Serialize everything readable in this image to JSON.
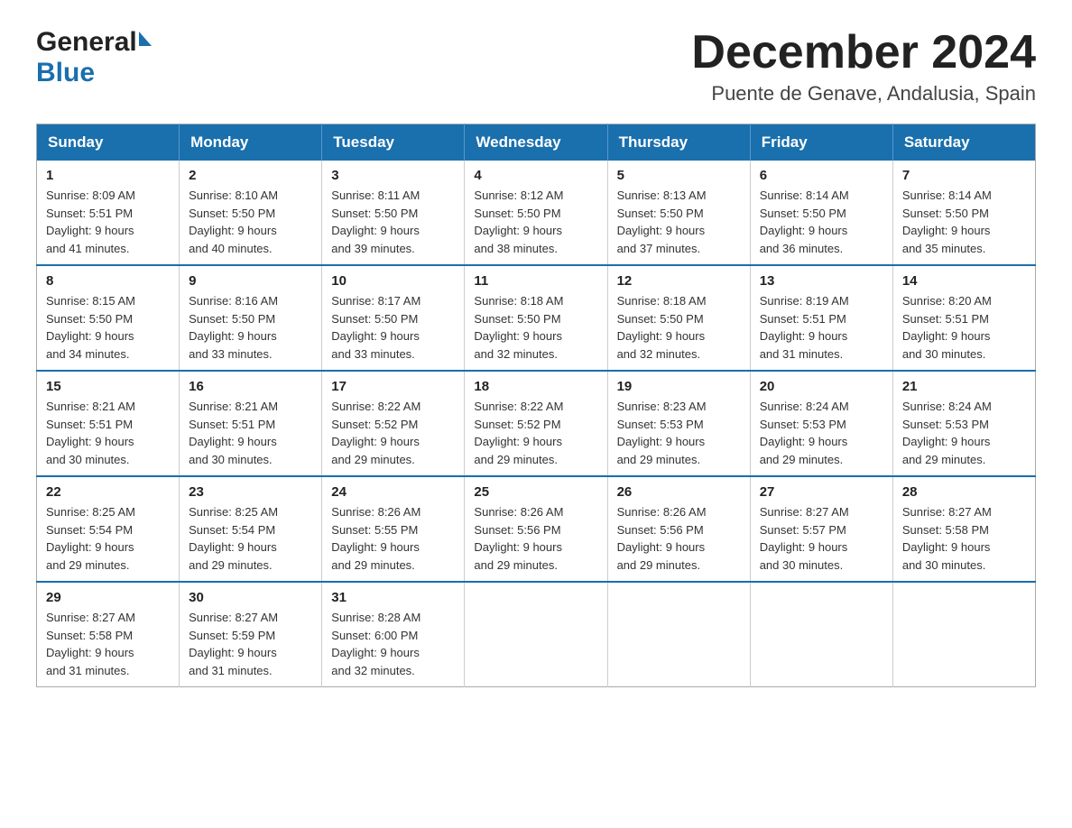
{
  "header": {
    "logo_general": "General",
    "logo_blue": "Blue",
    "month_year": "December 2024",
    "location": "Puente de Genave, Andalusia, Spain"
  },
  "weekdays": [
    "Sunday",
    "Monday",
    "Tuesday",
    "Wednesday",
    "Thursday",
    "Friday",
    "Saturday"
  ],
  "weeks": [
    [
      {
        "day": "1",
        "info": "Sunrise: 8:09 AM\nSunset: 5:51 PM\nDaylight: 9 hours\nand 41 minutes."
      },
      {
        "day": "2",
        "info": "Sunrise: 8:10 AM\nSunset: 5:50 PM\nDaylight: 9 hours\nand 40 minutes."
      },
      {
        "day": "3",
        "info": "Sunrise: 8:11 AM\nSunset: 5:50 PM\nDaylight: 9 hours\nand 39 minutes."
      },
      {
        "day": "4",
        "info": "Sunrise: 8:12 AM\nSunset: 5:50 PM\nDaylight: 9 hours\nand 38 minutes."
      },
      {
        "day": "5",
        "info": "Sunrise: 8:13 AM\nSunset: 5:50 PM\nDaylight: 9 hours\nand 37 minutes."
      },
      {
        "day": "6",
        "info": "Sunrise: 8:14 AM\nSunset: 5:50 PM\nDaylight: 9 hours\nand 36 minutes."
      },
      {
        "day": "7",
        "info": "Sunrise: 8:14 AM\nSunset: 5:50 PM\nDaylight: 9 hours\nand 35 minutes."
      }
    ],
    [
      {
        "day": "8",
        "info": "Sunrise: 8:15 AM\nSunset: 5:50 PM\nDaylight: 9 hours\nand 34 minutes."
      },
      {
        "day": "9",
        "info": "Sunrise: 8:16 AM\nSunset: 5:50 PM\nDaylight: 9 hours\nand 33 minutes."
      },
      {
        "day": "10",
        "info": "Sunrise: 8:17 AM\nSunset: 5:50 PM\nDaylight: 9 hours\nand 33 minutes."
      },
      {
        "day": "11",
        "info": "Sunrise: 8:18 AM\nSunset: 5:50 PM\nDaylight: 9 hours\nand 32 minutes."
      },
      {
        "day": "12",
        "info": "Sunrise: 8:18 AM\nSunset: 5:50 PM\nDaylight: 9 hours\nand 32 minutes."
      },
      {
        "day": "13",
        "info": "Sunrise: 8:19 AM\nSunset: 5:51 PM\nDaylight: 9 hours\nand 31 minutes."
      },
      {
        "day": "14",
        "info": "Sunrise: 8:20 AM\nSunset: 5:51 PM\nDaylight: 9 hours\nand 30 minutes."
      }
    ],
    [
      {
        "day": "15",
        "info": "Sunrise: 8:21 AM\nSunset: 5:51 PM\nDaylight: 9 hours\nand 30 minutes."
      },
      {
        "day": "16",
        "info": "Sunrise: 8:21 AM\nSunset: 5:51 PM\nDaylight: 9 hours\nand 30 minutes."
      },
      {
        "day": "17",
        "info": "Sunrise: 8:22 AM\nSunset: 5:52 PM\nDaylight: 9 hours\nand 29 minutes."
      },
      {
        "day": "18",
        "info": "Sunrise: 8:22 AM\nSunset: 5:52 PM\nDaylight: 9 hours\nand 29 minutes."
      },
      {
        "day": "19",
        "info": "Sunrise: 8:23 AM\nSunset: 5:53 PM\nDaylight: 9 hours\nand 29 minutes."
      },
      {
        "day": "20",
        "info": "Sunrise: 8:24 AM\nSunset: 5:53 PM\nDaylight: 9 hours\nand 29 minutes."
      },
      {
        "day": "21",
        "info": "Sunrise: 8:24 AM\nSunset: 5:53 PM\nDaylight: 9 hours\nand 29 minutes."
      }
    ],
    [
      {
        "day": "22",
        "info": "Sunrise: 8:25 AM\nSunset: 5:54 PM\nDaylight: 9 hours\nand 29 minutes."
      },
      {
        "day": "23",
        "info": "Sunrise: 8:25 AM\nSunset: 5:54 PM\nDaylight: 9 hours\nand 29 minutes."
      },
      {
        "day": "24",
        "info": "Sunrise: 8:26 AM\nSunset: 5:55 PM\nDaylight: 9 hours\nand 29 minutes."
      },
      {
        "day": "25",
        "info": "Sunrise: 8:26 AM\nSunset: 5:56 PM\nDaylight: 9 hours\nand 29 minutes."
      },
      {
        "day": "26",
        "info": "Sunrise: 8:26 AM\nSunset: 5:56 PM\nDaylight: 9 hours\nand 29 minutes."
      },
      {
        "day": "27",
        "info": "Sunrise: 8:27 AM\nSunset: 5:57 PM\nDaylight: 9 hours\nand 30 minutes."
      },
      {
        "day": "28",
        "info": "Sunrise: 8:27 AM\nSunset: 5:58 PM\nDaylight: 9 hours\nand 30 minutes."
      }
    ],
    [
      {
        "day": "29",
        "info": "Sunrise: 8:27 AM\nSunset: 5:58 PM\nDaylight: 9 hours\nand 31 minutes."
      },
      {
        "day": "30",
        "info": "Sunrise: 8:27 AM\nSunset: 5:59 PM\nDaylight: 9 hours\nand 31 minutes."
      },
      {
        "day": "31",
        "info": "Sunrise: 8:28 AM\nSunset: 6:00 PM\nDaylight: 9 hours\nand 32 minutes."
      },
      {
        "day": "",
        "info": ""
      },
      {
        "day": "",
        "info": ""
      },
      {
        "day": "",
        "info": ""
      },
      {
        "day": "",
        "info": ""
      }
    ]
  ]
}
